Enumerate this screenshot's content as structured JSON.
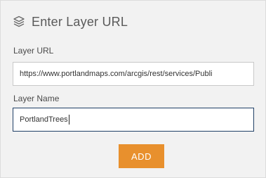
{
  "header": {
    "icon": "layers-icon",
    "title": "Enter Layer URL"
  },
  "form": {
    "url_label": "Layer URL",
    "url_value": "https://www.portlandmaps.com/arcgis/rest/services/Publi",
    "name_label": "Layer Name",
    "name_value": "PortlandTrees",
    "add_label": "ADD"
  },
  "colors": {
    "panel_background": "#f2f2f2",
    "accent_button": "#e8902d",
    "focused_border": "#1f3f66"
  }
}
